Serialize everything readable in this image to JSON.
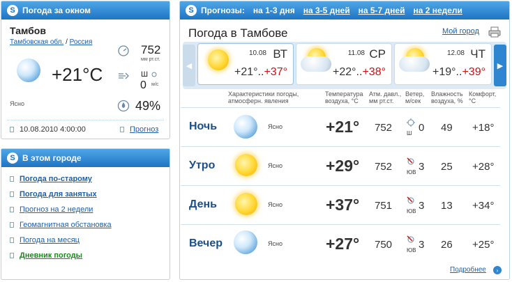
{
  "now": {
    "header": "Погода за окном",
    "city": "Тамбов",
    "region": "Тамбовская обл.",
    "country": "Россия",
    "temp": "+21°C",
    "condition": "Ясно",
    "pressure": "752",
    "pressure_unit": "мм рт.ст.",
    "wind_dir": "Ш",
    "wind_speed": "0",
    "wind_unit": "м/с",
    "humidity": "49%",
    "datetime": "10.08.2010 4:00:00",
    "forecast_link": "Прогноз"
  },
  "city_box": {
    "header": "В этом городе",
    "links": [
      {
        "label": "Погода по-старому"
      },
      {
        "label": "Погода для занятых"
      },
      {
        "label": "Прогноз на 2 недели"
      },
      {
        "label": "Геомагнитная обстановка"
      },
      {
        "label": "Погода на месяц"
      },
      {
        "label": "Дневник погоды"
      }
    ]
  },
  "forecast": {
    "label": "Прогнозы:",
    "tabs": [
      {
        "label": "на 1-3 дня"
      },
      {
        "label": "на 3-5 дней"
      },
      {
        "label": "на 5-7 дней"
      },
      {
        "label": "на 2 недели"
      }
    ],
    "title": "Погода в Тамбове",
    "my_city": "Мой город",
    "days": [
      {
        "date": "10.08",
        "dow": "ВТ",
        "low": "+21°..",
        "high": "+37°"
      },
      {
        "date": "11.08",
        "dow": "СР",
        "low": "+22°..",
        "high": "+38°"
      },
      {
        "date": "12.08",
        "dow": "ЧТ",
        "low": "+19°..",
        "high": "+39°"
      }
    ],
    "headers": {
      "conditions": "Характеристики погоды, атмосферн. явления",
      "temp": "Температура воздуха, °С",
      "pressure": "Атм. давл., мм рт.ст.",
      "wind": "Ветер, м/сек",
      "humidity": "Влажность воздуха, %",
      "comfort": "Комфорт, °С"
    },
    "rows": [
      {
        "name": "Ночь",
        "cond": "Ясно",
        "icon": "moon",
        "temp": "+21°",
        "pressure": "752",
        "wind_dir": "Ш",
        "wind": "0",
        "humidity": "49",
        "comfort": "+18°"
      },
      {
        "name": "Утро",
        "cond": "Ясно",
        "icon": "sun",
        "temp": "+29°",
        "pressure": "752",
        "wind_dir": "ЮВ",
        "wind": "3",
        "humidity": "25",
        "comfort": "+28°"
      },
      {
        "name": "День",
        "cond": "Ясно",
        "icon": "sun",
        "temp": "+37°",
        "pressure": "751",
        "wind_dir": "ЮВ",
        "wind": "3",
        "humidity": "13",
        "comfort": "+34°"
      },
      {
        "name": "Вечер",
        "cond": "Ясно",
        "icon": "moon",
        "temp": "+27°",
        "pressure": "750",
        "wind_dir": "ЮВ",
        "wind": "3",
        "humidity": "26",
        "comfort": "+25°"
      }
    ],
    "more": "Подробнее"
  }
}
